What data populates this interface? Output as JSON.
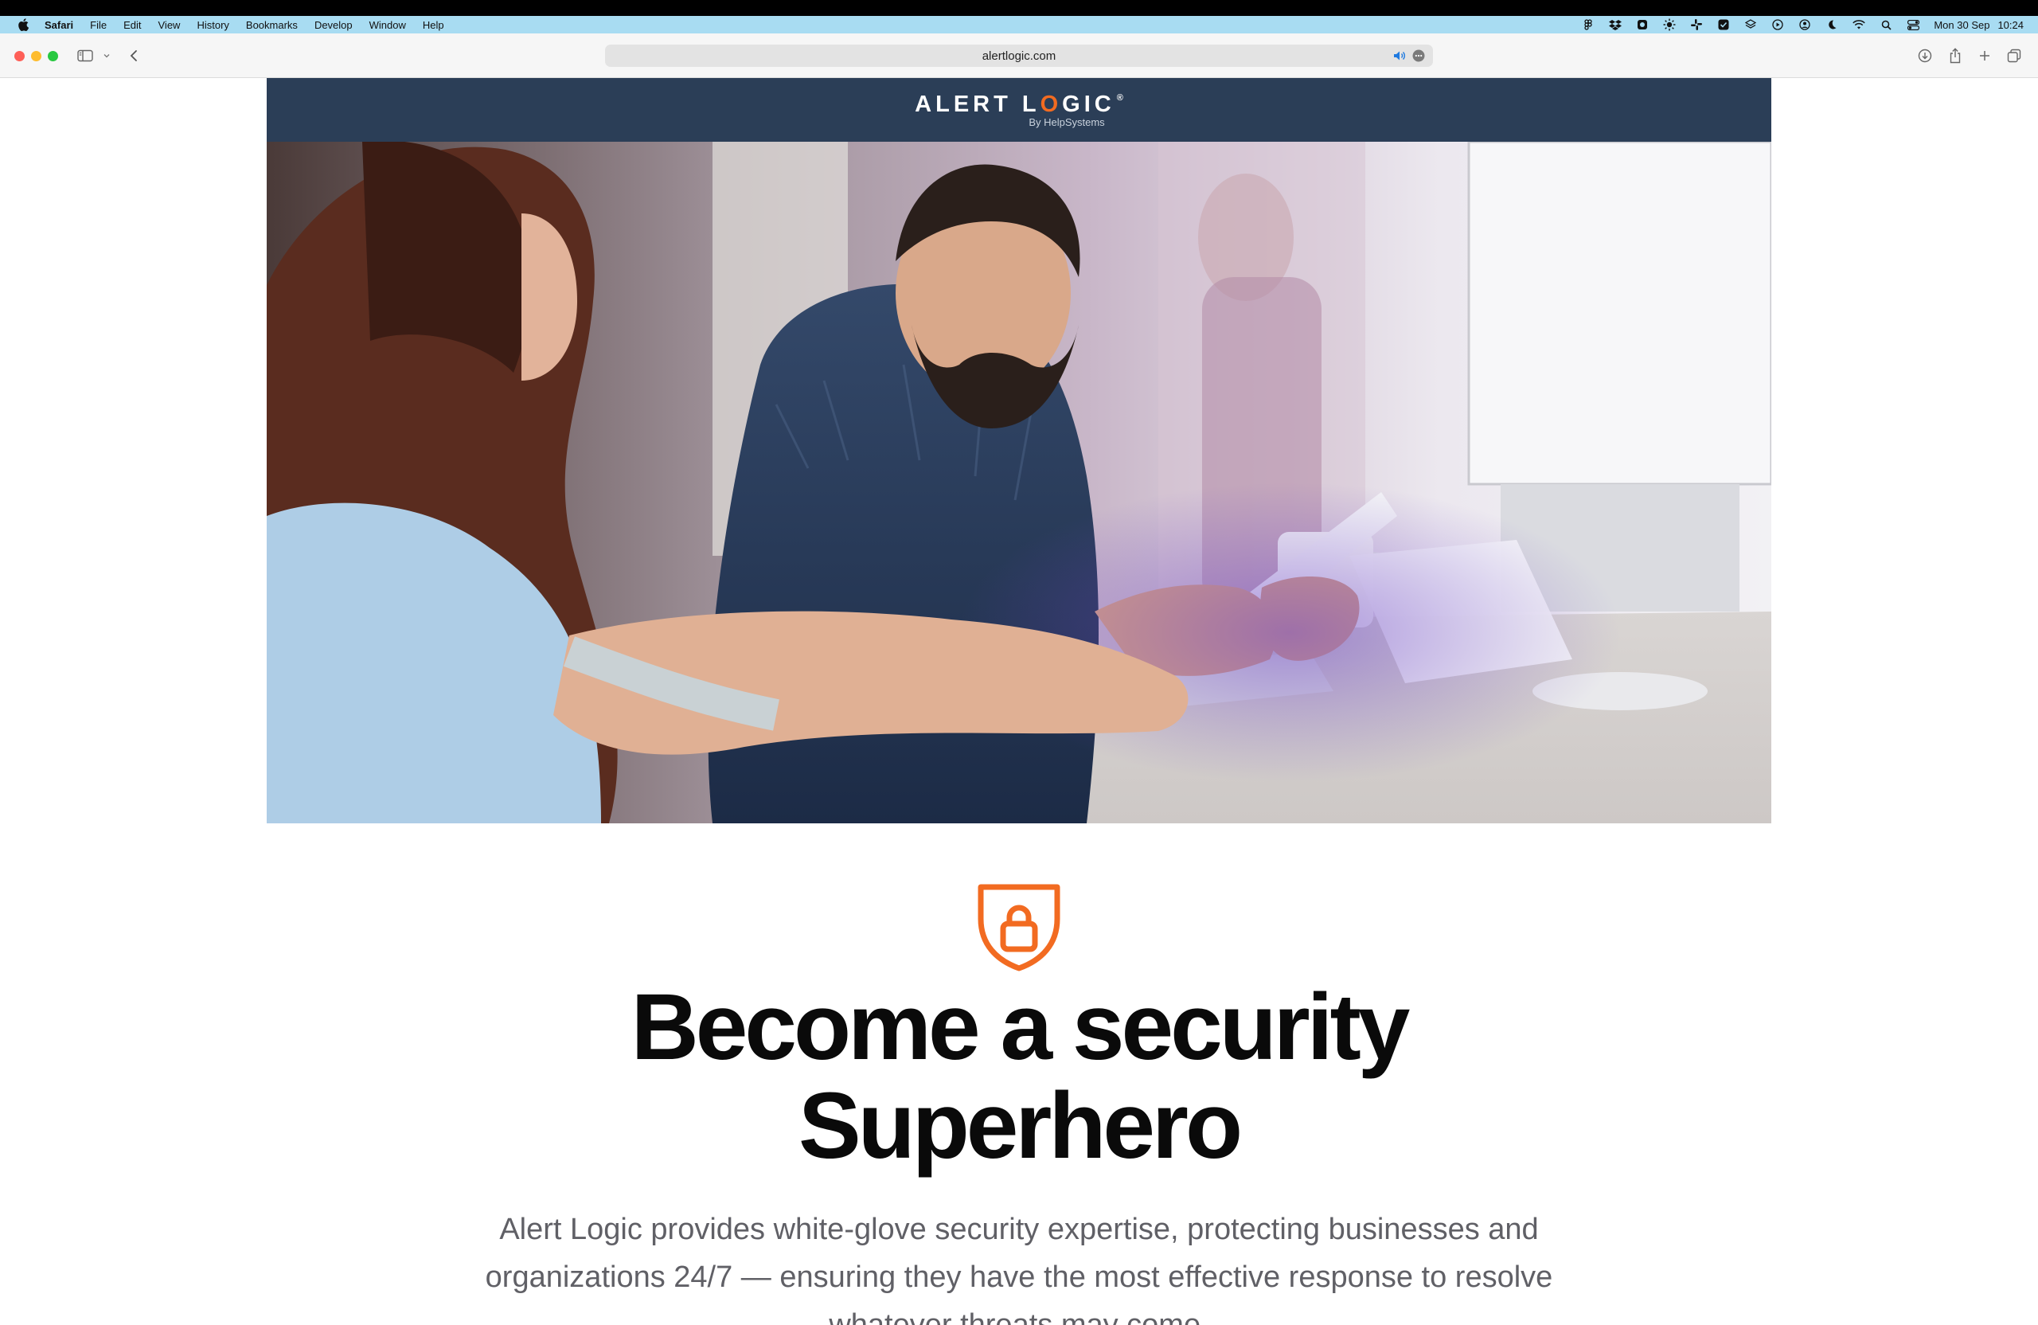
{
  "menubar": {
    "app_name": "Safari",
    "items": [
      "File",
      "Edit",
      "View",
      "History",
      "Bookmarks",
      "Develop",
      "Window",
      "Help"
    ],
    "clock": {
      "date": "Mon 30 Sep",
      "time": "10:24"
    }
  },
  "browser": {
    "url": "alertlogic.com"
  },
  "brand": {
    "logo_prefix": "ALERT L",
    "logo_accent": "O",
    "logo_suffix": "GIC",
    "logo_mark": "®",
    "tagline": "By HelpSystems",
    "colors": {
      "bar": "#2b3e57",
      "accent": "#f26b21"
    }
  },
  "hero": {
    "image": "office-colleagues-reviewing-documents-photo"
  },
  "main": {
    "icon": "shield-lock-icon",
    "headline_line1": "Become a security",
    "headline_line2": "Superhero",
    "body": "Alert Logic provides white-glove security expertise, protecting businesses and organizations 24/7 — ensuring they have the most effective response to resolve whatever threats may come."
  }
}
